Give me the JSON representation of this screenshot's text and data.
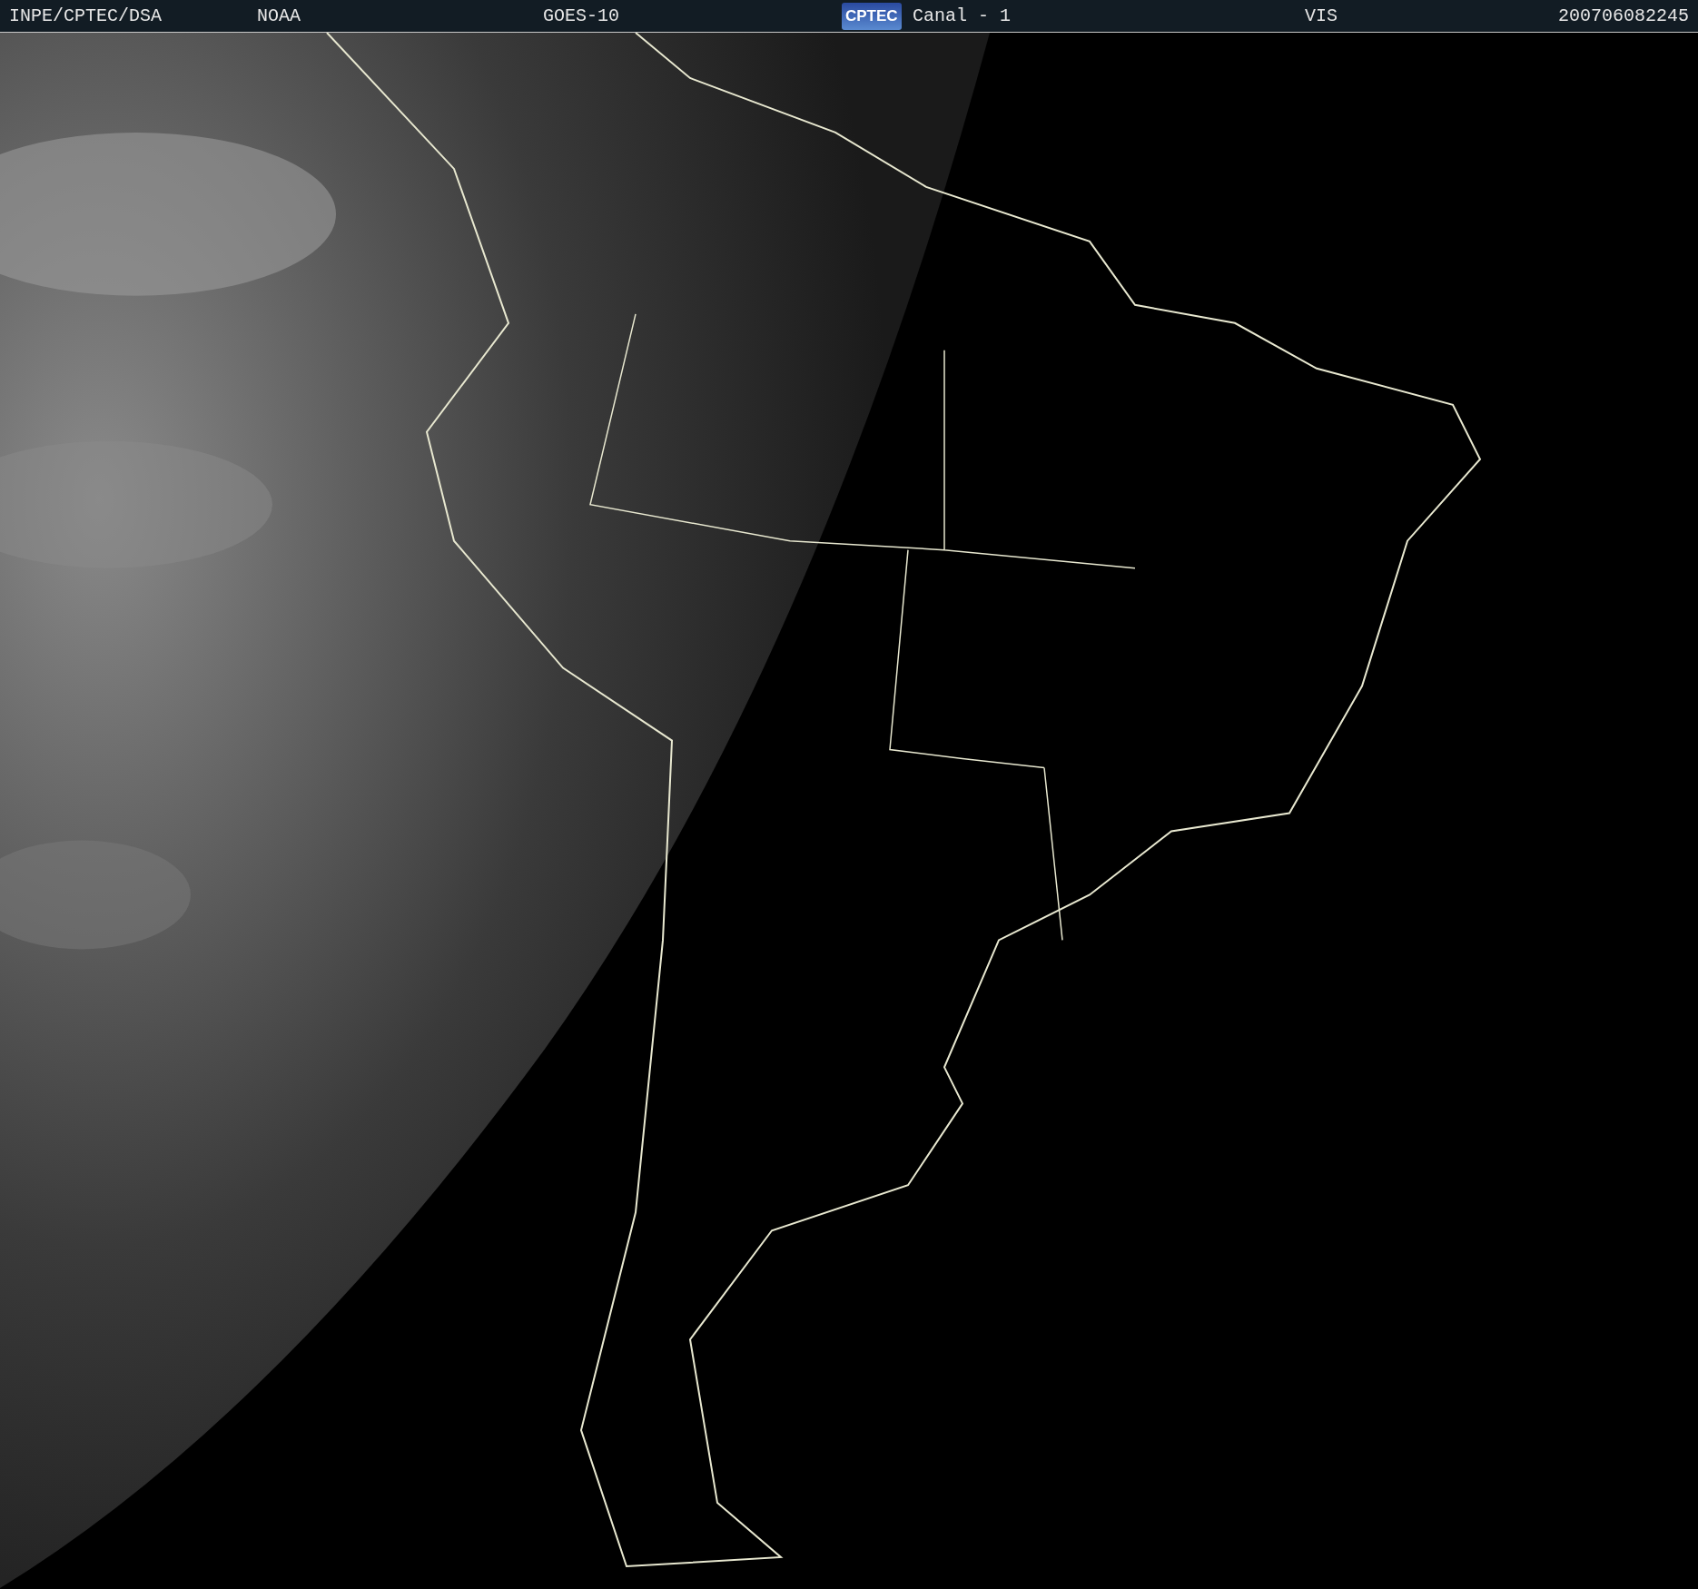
{
  "header": {
    "source": "INPE/CPTEC/DSA",
    "agency": "NOAA",
    "satellite": "GOES-10",
    "logo": "CPTEC",
    "channel": "Canal - 1",
    "band": "VIS",
    "timestamp": "200706082245"
  }
}
